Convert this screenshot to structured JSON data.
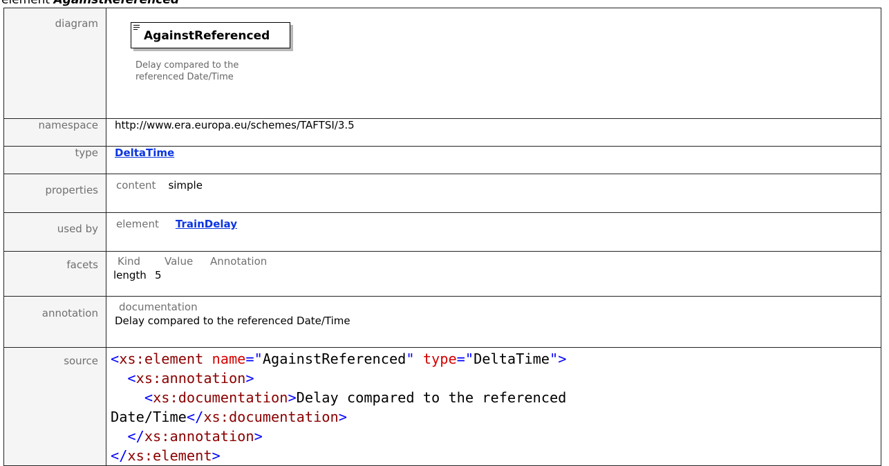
{
  "title": {
    "prefix": "element ",
    "name": "AgainstReferenced"
  },
  "rows": {
    "diagram": {
      "label": "diagram",
      "element_name": "AgainstReferenced",
      "description": "Delay compared to the referenced Date/Time"
    },
    "namespace": {
      "label": "namespace",
      "value": "http://www.era.europa.eu/schemes/TAFTSI/3.5"
    },
    "type": {
      "label": "type",
      "value": "DeltaTime"
    },
    "properties": {
      "label": "properties",
      "key": "content",
      "value": "simple"
    },
    "used_by": {
      "label": "used by",
      "key": "element",
      "value": "TrainDelay"
    },
    "facets": {
      "label": "facets",
      "headers": [
        "Kind",
        "Value",
        "Annotation"
      ],
      "rows": [
        {
          "kind": "length",
          "value": "5",
          "annotation": ""
        }
      ]
    },
    "annotation": {
      "label": "annotation",
      "key": "documentation",
      "value": "Delay compared to the referenced Date/Time"
    },
    "source": {
      "label": "source",
      "tag_element": "xs:element",
      "attr_name": "name",
      "attr_name_value": "AgainstReferenced",
      "attr_type": "type",
      "attr_type_value": "DeltaTime",
      "tag_annotation": "xs:annotation",
      "tag_documentation": "xs:documentation",
      "doc_text": "Delay compared to the referenced Date/Time"
    }
  }
}
